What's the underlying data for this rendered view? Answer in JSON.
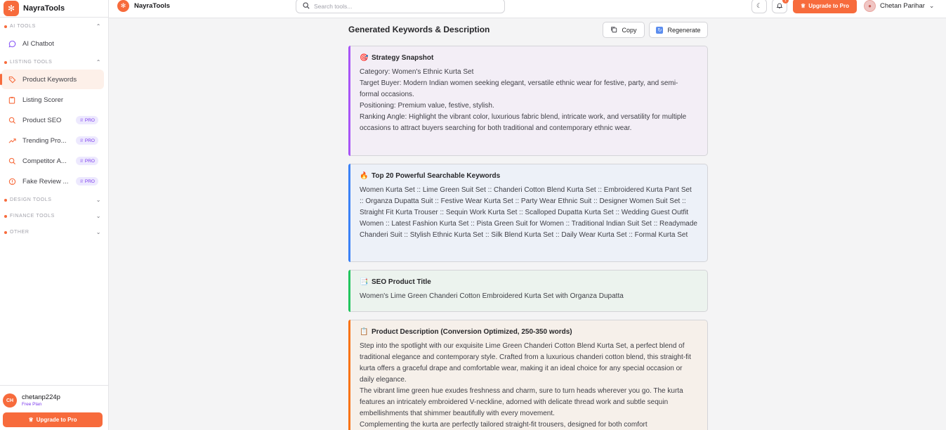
{
  "sidebar": {
    "brand": "NayraTools",
    "sections": {
      "ai_tools": "AI TOOLS",
      "listing_tools": "LISTING TOOLS",
      "design_tools": "DESIGN TOOLS",
      "finance_tools": "FINANCE TOOLS",
      "other": "OTHER"
    },
    "items": [
      {
        "label": "AI Chatbot",
        "icon": "chat-bubble-icon"
      },
      {
        "label": "Product Keywords",
        "icon": "tags-icon",
        "active": true
      },
      {
        "label": "Listing Scorer",
        "icon": "clipboard-icon"
      },
      {
        "label": "Product SEO",
        "icon": "search-chart-icon",
        "badge": "PRO"
      },
      {
        "label": "Trending Pro...",
        "icon": "trending-up-icon",
        "badge": "PRO"
      },
      {
        "label": "Competitor A...",
        "icon": "search-icon",
        "badge": "PRO"
      },
      {
        "label": "Fake Review ...",
        "icon": "alert-circle-icon",
        "badge": "PRO"
      }
    ],
    "user": {
      "initials": "CH",
      "name": "chetanp224p",
      "plan": "Free Plan"
    },
    "upgrade_label": "Upgrade to Pro"
  },
  "topbar": {
    "brand": "NayraTools",
    "search_placeholder": "Search tools...",
    "notification_count": "1",
    "upgrade_label": "Upgrade to Pro",
    "profile_name": "Chetan Parihar"
  },
  "main": {
    "title": "Generated Keywords & Description",
    "copy_label": "Copy",
    "regenerate_label": "Regenerate",
    "cards": {
      "strategy": {
        "emoji": "🎯",
        "title": "Strategy Snapshot",
        "line1": "Category: Women's Ethnic Kurta Set",
        "line2": "Target Buyer: Modern Indian women seeking elegant, versatile ethnic wear for festive, party, and semi-formal occasions.",
        "line3": "Positioning: Premium value, festive, stylish.",
        "line4": "Ranking Angle: Highlight the vibrant color, luxurious fabric blend, intricate work, and versatility for multiple occasions to attract buyers searching for both traditional and contemporary ethnic wear."
      },
      "keywords": {
        "emoji": "🔥",
        "title": "Top 20 Powerful Searchable Keywords",
        "body": "Women Kurta Set :: Lime Green Suit Set :: Chanderi Cotton Blend Kurta Set :: Embroidered Kurta Pant Set :: Organza Dupatta Suit :: Festive Wear Kurta Set :: Party Wear Ethnic Suit :: Designer Women Suit Set :: Straight Fit Kurta Trouser :: Sequin Work Kurta Set :: Scalloped Dupatta Kurta Set :: Wedding Guest Outfit Women :: Latest Fashion Kurta Set :: Pista Green Suit for Women :: Traditional Indian Suit Set :: Readymade Chanderi Suit :: Stylish Ethnic Kurta Set :: Silk Blend Kurta Set :: Daily Wear Kurta Set :: Formal Kurta Set"
      },
      "seo_title": {
        "emoji": "📑",
        "title": "SEO Product Title",
        "body": "Women's Lime Green Chanderi Cotton Embroidered Kurta Set with Organza Dupatta"
      },
      "description": {
        "emoji": "📋",
        "title": "Product Description (Conversion Optimized, 250-350 words)",
        "para1": "Step into the spotlight with our exquisite Lime Green Chanderi Cotton Blend Kurta Set, a perfect blend of traditional elegance and contemporary style. Crafted from a luxurious chanderi cotton blend, this straight-fit kurta offers a graceful drape and comfortable wear, making it an ideal choice for any special occasion or daily elegance.",
        "para2": "The vibrant lime green hue exudes freshness and charm, sure to turn heads wherever you go. The kurta features an intricately embroidered V-neckline, adorned with delicate thread work and subtle sequin embellishments that shimmer beautifully with every movement.",
        "para3": "Complementing the kurta are perfectly tailored straight-fit trousers, designed for both comfort"
      }
    }
  },
  "colors": {
    "accent": "#f76b3c",
    "pro_badge": "#7c3aed"
  }
}
